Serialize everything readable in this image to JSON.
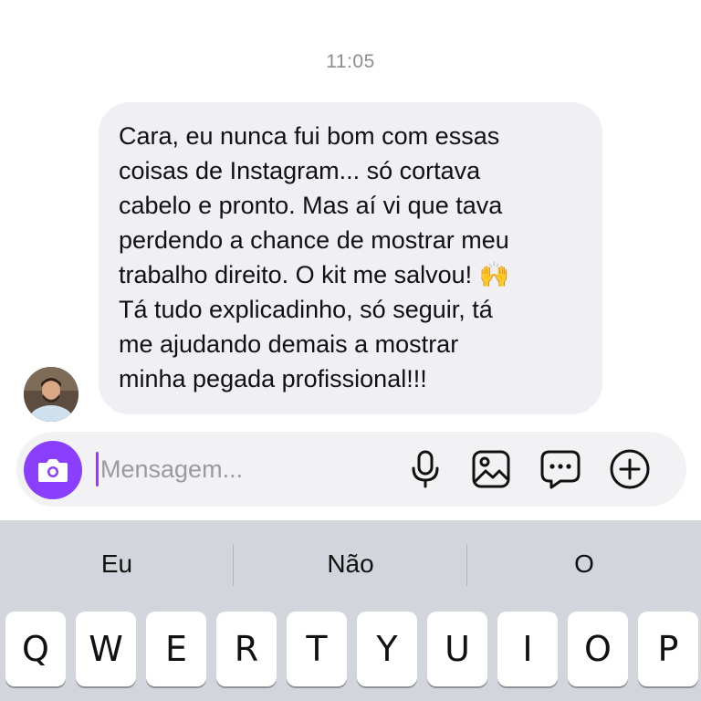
{
  "conversation": {
    "timestamp": "11:05",
    "message": {
      "text": "Cara, eu nunca fui bom com essas\ncoisas de Instagram... só cortava\ncabelo e pronto. Mas aí vi que tava\nperdendo a chance de mostrar meu\ntrabalho direito. O kit me salvou! 🙌\nTá tudo explicadinho, só seguir, tá\nme ajudando demais a mostrar\nminha pegada profissional!!!"
    }
  },
  "composer": {
    "placeholder": "Mensagem...",
    "value": "",
    "icons": [
      "camera-icon",
      "microphone-icon",
      "gallery-icon",
      "sticker-chat-icon",
      "plus-icon"
    ]
  },
  "keyboard": {
    "suggestions": [
      "Eu",
      "Não",
      "O"
    ],
    "top_row": [
      "Q",
      "W",
      "E",
      "R",
      "T",
      "Y",
      "U",
      "I",
      "O",
      "P"
    ]
  },
  "colors": {
    "accent": "#8a3ffc",
    "bubble": "#efeff4",
    "keyboard_bg": "#d3d5dc",
    "timestamp": "#8a8d93"
  }
}
